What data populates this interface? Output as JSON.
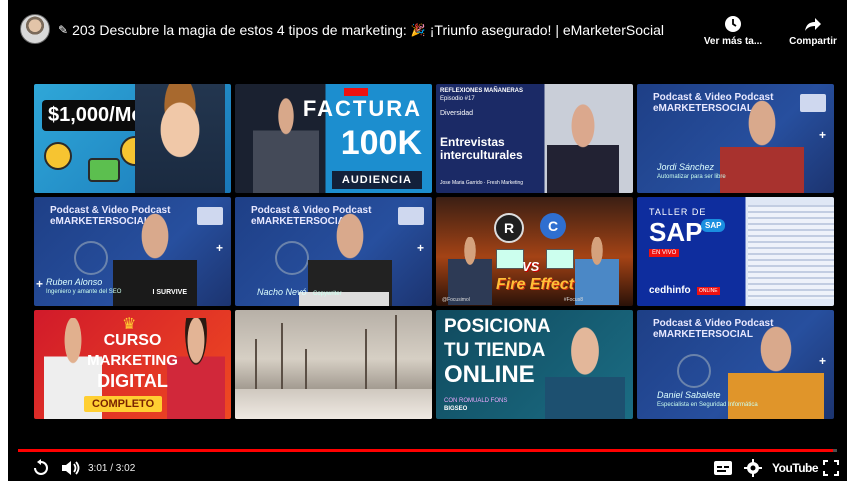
{
  "video": {
    "number": "203",
    "title_part1": "Descubre la magia de estos 4 tipos de marketing:",
    "title_part2": "¡Triunfo asegurado! | eMarketerSocial",
    "watch_later_label": "Ver más ta...",
    "share_label": "Compartir"
  },
  "end_screen": {
    "tiles": [
      {
        "headline": "$1,000/Mes"
      },
      {
        "badge": "",
        "line1": "FACTURA",
        "line2": "100K",
        "footer": "AUDIENCIA"
      },
      {
        "top1": "REFLEXIONES MAÑANERAS",
        "top2": "Episodio #17",
        "tag": "Diversidad",
        "line1": "Entrevistas",
        "line2": "interculturales",
        "caption": "Jose Maria Garrido · Fresh Marketing"
      },
      {
        "head1": "Podcast & Video Podcast",
        "head2": "eMARKETERSOCIAL",
        "guest": "Jordi Sánchez",
        "role": "Automatizar para ser libre"
      },
      {
        "head1": "Podcast & Video Podcast",
        "head2": "eMARKETERSOCIAL",
        "guest": "Ruben Alonso",
        "role": "Ingeniero y amante del SEO",
        "shirt_text": "I SURVIVE"
      },
      {
        "head1": "Podcast & Video Podcast",
        "head2": "eMARKETERSOCIAL",
        "guest": "Nacho Nevó",
        "role": "Copywriter"
      },
      {
        "r": "R",
        "c": "C",
        "vs": "VS",
        "title": "Fire Effect",
        "handle": "@Focusimol",
        "tag": "#Focus8"
      },
      {
        "taller": "TALLER DE",
        "sap": "SAP",
        "sap_badge": "SAP",
        "envivo": "EN VIVO",
        "brand": "cedhinfo",
        "live": "ONLINE"
      },
      {
        "line1": "CURSO",
        "line2": "MARKETING",
        "line3": "DIGITAL",
        "line4": "COMPLETO"
      },
      {},
      {
        "line1": "POSICIONA",
        "line2": "TU TIENDA",
        "line3": "ONLINE",
        "con": "CON ROMUALD FONS",
        "brand": "BIGSEO"
      },
      {
        "head1": "Podcast & Video Podcast",
        "head2": "eMARKETERSOCIAL",
        "guest": "Daniel Sabalete",
        "role": "Especialista en Seguridad Informática"
      }
    ]
  },
  "player": {
    "current_time": "3:01",
    "duration": "3:02",
    "time_display": "3:01 / 3:02",
    "progress_fraction": 0.995,
    "youtube_label": "YouTube",
    "accent_color": "#ff0000"
  }
}
